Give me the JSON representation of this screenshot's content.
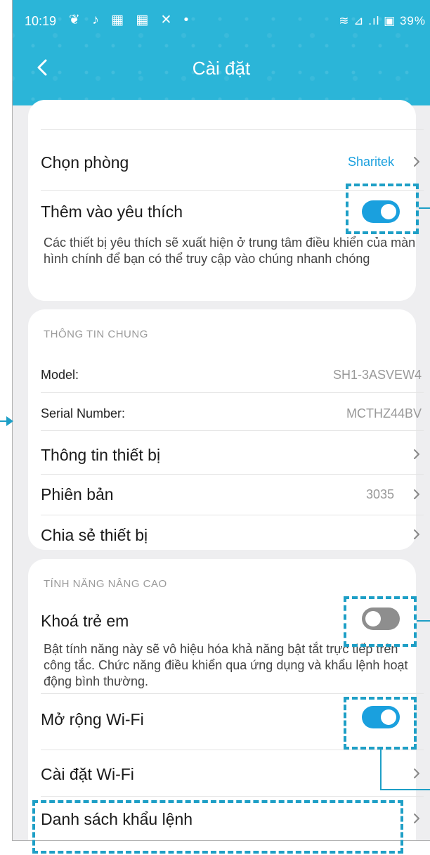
{
  "status_bar": {
    "time": "10:19",
    "app_icons": "❦ ♪ ▦ ▦ ✕ •",
    "right": "≋ ⊿ .ıl ▣ 39%"
  },
  "header": {
    "title": "Cài đặt"
  },
  "settings": {
    "room_label": "Chọn phòng",
    "room_value": "Sharitek",
    "favorite_label": "Thêm vào yêu thích",
    "favorite_on": true,
    "favorite_desc": "Các thiết bị yêu thích sẽ xuất hiện ở trung tâm điều khiển của màn hình chính để bạn có thể truy cập vào chúng nhanh chóng"
  },
  "general": {
    "section": "THÔNG TIN CHUNG",
    "model_label": "Model:",
    "model_value": "SH1-3ASVEW4",
    "serial_label": "Serial Number:",
    "serial_value": "MCTHZ44BV",
    "device_info": "Thông tin thiết bị",
    "version_label": "Phiên bản",
    "version_value": "3035",
    "share_label": "Chia sẻ thiết bị"
  },
  "advanced": {
    "section": "TÍNH NĂNG NÂNG CAO",
    "child_lock_label": "Khoá trẻ em",
    "child_lock_on": false,
    "child_lock_desc": "Bật tính năng này sẽ vô hiệu hóa khả năng bật tắt trực tiếp trên công tắc. Chức năng điều khiển qua ứng dụng và khẩu lệnh hoạt động bình thường.",
    "wifi_extend_label": "Mở rộng Wi-Fi",
    "wifi_extend_on": true,
    "wifi_settings_label": "Cài đặt Wi-Fi",
    "command_list_label": "Danh sách khẩu lệnh"
  },
  "colors": {
    "header": "#2bb5d8",
    "toggle_on": "#1aa0de",
    "toggle_off": "#8e8e8e",
    "annotation": "#1e9fc6"
  }
}
